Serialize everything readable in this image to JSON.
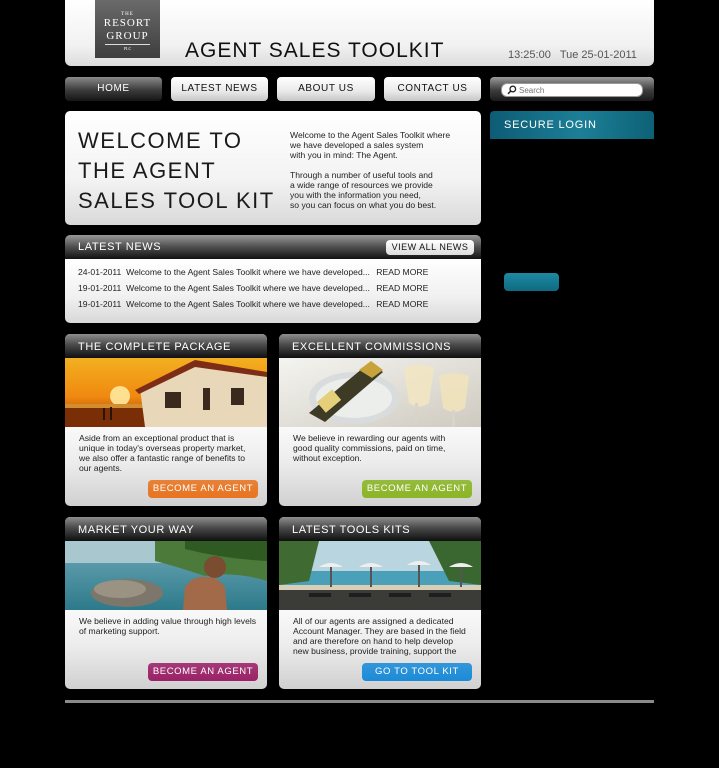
{
  "header": {
    "logo": {
      "line1": "THE",
      "line2": "RESORT",
      "line3": "GROUP",
      "line4": "PLC"
    },
    "title": "AGENT SALES TOOLKIT",
    "time": "13:25:00",
    "date": "Tue 25-01-2011"
  },
  "nav": {
    "items": [
      {
        "label": "HOME"
      },
      {
        "label": "LATEST NEWS"
      },
      {
        "label": "ABOUT US"
      },
      {
        "label": "CONTACT US"
      }
    ]
  },
  "search": {
    "placeholder": "Search"
  },
  "welcome": {
    "heading": "WELCOME TO THE AGENT SALES TOOL KIT",
    "para1": [
      "Welcome to the Agent Sales Toolkit where",
      "we have developed a sales system",
      "with you in mind: The Agent."
    ],
    "para2": [
      "Through a number of useful tools and",
      "a wide range of resources we provide",
      "you with the information you need,",
      "so you can focus on what you do best."
    ]
  },
  "login": {
    "title": "SECURE LOGIN"
  },
  "news": {
    "title": "LATEST NEWS",
    "view_all": "VIEW ALL NEWS",
    "items": [
      {
        "date": "24-01-2011",
        "text": "Welcome to the Agent Sales Toolkit where we have developed...",
        "more": "READ MORE"
      },
      {
        "date": "19-01-2011",
        "text": "Welcome to the Agent Sales Toolkit where we have developed...",
        "more": "READ MORE"
      },
      {
        "date": "19-01-2011",
        "text": "Welcome to the Agent Sales Toolkit where we have developed...",
        "more": "READ MORE"
      }
    ]
  },
  "panels": {
    "package": {
      "title": "THE COMPLETE PACKAGE",
      "lines": [
        "Aside from an exceptional product that is",
        "unique in today's overseas property market,",
        "we also offer a fantastic range of benefits to",
        "our agents."
      ],
      "button": "BECOME AN AGENT",
      "button_color": "#e8741f"
    },
    "commissions": {
      "title": "EXCELLENT COMMISSIONS",
      "lines": [
        "We believe in rewarding our agents with",
        "good quality commissions, paid on time,",
        "without exception."
      ],
      "button": "BECOME AN AGENT",
      "button_color": "#8bb525"
    },
    "market": {
      "title": "MARKET YOUR WAY",
      "lines": [
        "We believe in adding value through high levels",
        "of marketing support."
      ],
      "button": "BECOME AN AGENT",
      "button_color": "#9b2167"
    },
    "tools": {
      "title": "LATEST TOOLS KITS",
      "lines": [
        "All of our agents are assigned a dedicated",
        "Account Manager. They are based in the field",
        "and are therefore on hand to help develop",
        "new business, provide training, support the"
      ],
      "button": "GO TO TOOL KIT",
      "button_color": "#1a8bd8"
    }
  }
}
